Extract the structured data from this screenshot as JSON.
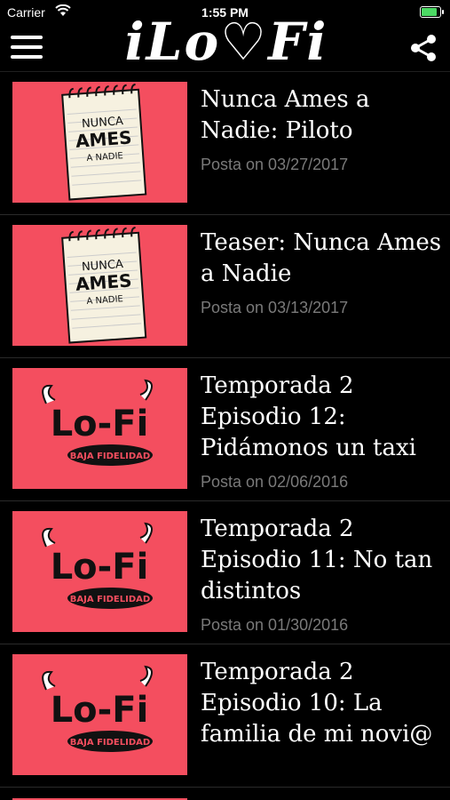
{
  "status": {
    "carrier": "Carrier",
    "time": "1:55 PM"
  },
  "header": {
    "logo_text": "iLo♡Fi",
    "menu_icon": "hamburger-menu-icon",
    "share_icon": "share-icon"
  },
  "colors": {
    "thumb_bg": "#f44e5f",
    "date_text": "#7a7a7a",
    "battery": "#4cd964"
  },
  "episodes": [
    {
      "title": "Nunca Ames a Nadie: Piloto",
      "date": "Posta on 03/27/2017",
      "art": "nunca-ames-notepad",
      "art_text": [
        "NUNCA",
        "AMES",
        "A NADIE"
      ]
    },
    {
      "title": "Teaser: Nunca Ames a Nadie",
      "date": "Posta on 03/13/2017",
      "art": "nunca-ames-notepad",
      "art_text": [
        "NUNCA",
        "AMES",
        "A NADIE"
      ]
    },
    {
      "title": "Temporada 2 Episodio 12: Pidámonos un taxi",
      "date": "Posta on 02/06/2016",
      "art": "lofi-bull-logo",
      "art_text": [
        "Lo-Fi",
        "BAJA FIDELIDAD"
      ]
    },
    {
      "title": "Temporada 2 Episodio 11: No tan distintos",
      "date": "Posta on 01/30/2016",
      "art": "lofi-bull-logo",
      "art_text": [
        "Lo-Fi",
        "BAJA FIDELIDAD"
      ]
    },
    {
      "title": "Temporada 2 Episodio 10: La familia de mi novi@",
      "date": "",
      "art": "lofi-bull-logo",
      "art_text": [
        "Lo-Fi",
        "BAJA FIDELIDAD"
      ]
    }
  ]
}
